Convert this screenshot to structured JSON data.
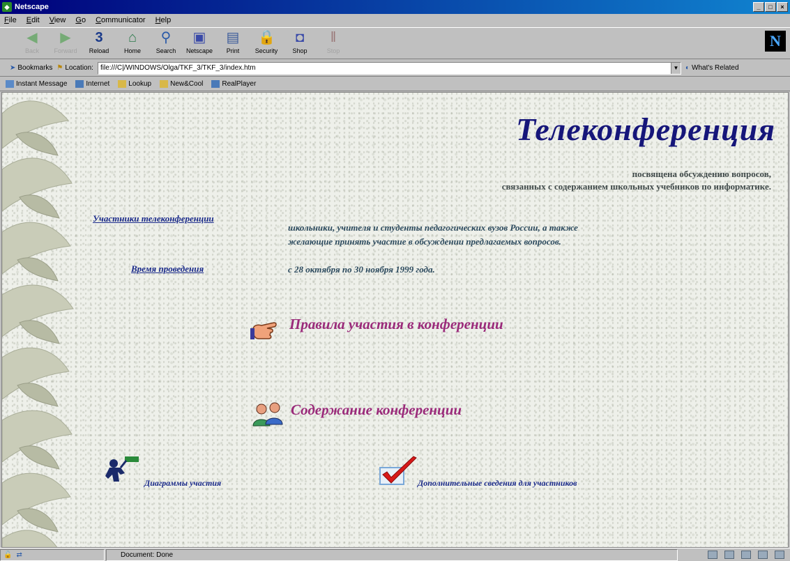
{
  "window": {
    "title": "Netscape",
    "buttons": [
      "_",
      "□",
      "×"
    ]
  },
  "menu": [
    "File",
    "Edit",
    "View",
    "Go",
    "Communicator",
    "Help"
  ],
  "toolbar": [
    {
      "label": "Back",
      "icon": "back-arrow-icon",
      "disabled": true
    },
    {
      "label": "Forward",
      "icon": "forward-arrow-icon",
      "disabled": true
    },
    {
      "label": "Reload",
      "icon": "reload-icon",
      "disabled": false
    },
    {
      "label": "Home",
      "icon": "home-icon",
      "disabled": false
    },
    {
      "label": "Search",
      "icon": "search-icon",
      "disabled": false
    },
    {
      "label": "Netscape",
      "icon": "netscape-icon",
      "disabled": false
    },
    {
      "label": "Print",
      "icon": "print-icon",
      "disabled": false
    },
    {
      "label": "Security",
      "icon": "security-icon",
      "disabled": false
    },
    {
      "label": "Shop",
      "icon": "shop-icon",
      "disabled": false
    },
    {
      "label": "Stop",
      "icon": "stop-icon",
      "disabled": true
    }
  ],
  "brand_logo": "N",
  "location": {
    "bookmarks_label": "Bookmarks",
    "location_label": "Location:",
    "url": "file:///C|/WINDOWS/Olga/TKF_3/TKF_3/index.htm",
    "whats_related": "What's Related"
  },
  "personal": [
    "Instant Message",
    "Internet",
    "Lookup",
    "New&Cool",
    "RealPlayer"
  ],
  "page": {
    "title": "Телеконференция",
    "subtitle_line1": "посвящена обсуждению вопросов,",
    "subtitle_line2": "связанных с содержанием школьных учебников по информатике.",
    "participants_label": "Участники телеконференции",
    "participants_text_line1": "школьники, учителя и студенты педагогических вузов России, а также",
    "participants_text_line2": "желающие принять участие в обсуждении предлагаемых вопросов.",
    "time_label": "Время проведения",
    "time_text": "с 28 октября по 30 ноября 1999 года.",
    "rules_link": "Правила участия в конференции",
    "contents_link": "Содержание конференции",
    "diagrams_link": "Диаграммы участия",
    "extra_info_link": "Дополнительные сведения для участников"
  },
  "status": {
    "text": "Document: Done"
  },
  "colors": {
    "title": "#16167a",
    "accent_link": "#9a2a7a",
    "link": "#1a2a8a"
  }
}
